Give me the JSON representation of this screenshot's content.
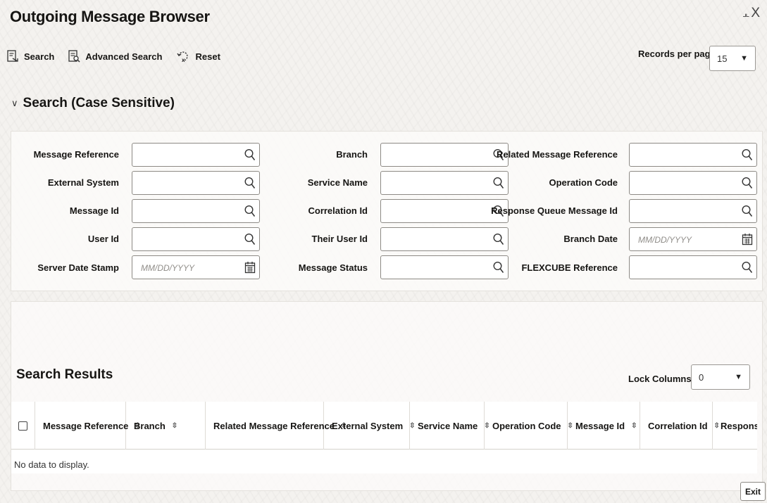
{
  "window": {
    "title": "Outgoing Message Browser",
    "minimize_glyph": "⌟⌞",
    "close_glyph": "X"
  },
  "toolbar": {
    "search_label": "Search",
    "advanced_search_label": "Advanced Search",
    "reset_label": "Reset"
  },
  "records_per_page": {
    "label": "Records per page",
    "value": "15"
  },
  "search_section": {
    "title": "Search (Case Sensitive)"
  },
  "fields": {
    "message_reference": "Message Reference",
    "branch": "Branch",
    "related_message_reference": "Related Message Reference",
    "external_system": "External System",
    "service_name": "Service Name",
    "operation_code": "Operation Code",
    "message_id": "Message Id",
    "correlation_id": "Correlation Id",
    "response_queue_message_id": "Response Queue Message Id",
    "user_id": "User Id",
    "their_user_id": "Their User Id",
    "branch_date": "Branch Date",
    "server_date_stamp": "Server Date Stamp",
    "message_status": "Message Status",
    "flexcube_reference": "FLEXCUBE Reference"
  },
  "date_placeholder": "MM/DD/YYYY",
  "results": {
    "title": "Search Results",
    "lock_columns_label": "Lock Columns",
    "lock_columns_value": "0",
    "columns": [
      "Message Reference",
      "Branch",
      "Related Message Reference",
      "External System",
      "Service Name",
      "Operation Code",
      "Message Id",
      "Correlation Id",
      "Response"
    ],
    "empty_text": "No data to display."
  },
  "footer": {
    "exit_label": "Exit"
  },
  "icons": {
    "search": "magnifier-icon",
    "calendar": "calendar-icon",
    "sort": "sort-icon"
  },
  "colors": {
    "background": "#f4f2ef",
    "text": "#161513",
    "border": "#8d8a85"
  }
}
